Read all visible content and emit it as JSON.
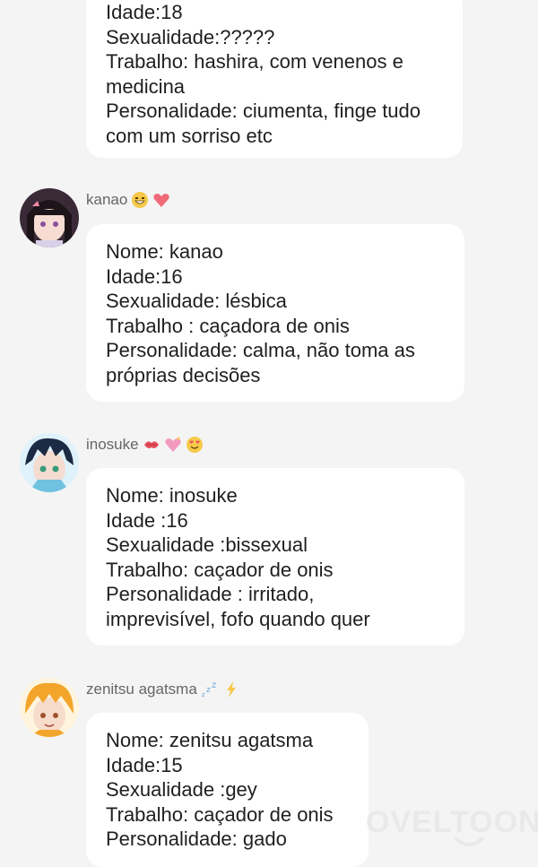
{
  "messages": [
    {
      "username": "",
      "emojis": [],
      "lines": [
        "Idade:18",
        "Sexualidade:?????",
        "Trabalho: hashira, com venenos e",
        "medicina",
        "Personalidade: ciumenta, finge tudo",
        "com um sorriso etc"
      ]
    },
    {
      "username": "kanao",
      "emojis": [
        "grinning-face-emoji",
        "red-heart-emoji"
      ],
      "lines": [
        "Nome: kanao",
        "Idade:16",
        "Sexualidade: lésbica",
        "Trabalho : caçadora de onis",
        "Personalidade: calma, não toma as",
        "próprias decisões"
      ]
    },
    {
      "username": "inosuke",
      "emojis": [
        "kiss-mark-emoji",
        "sparkling-heart-emoji",
        "heart-eyes-emoji"
      ],
      "lines": [
        "Nome: inosuke",
        "Idade :16",
        "Sexualidade :bissexual",
        "Trabalho: caçador de onis",
        "Personalidade : irritado,",
        "imprevisível, fofo quando quer"
      ]
    },
    {
      "username": "zenitsu agatsma",
      "emojis": [
        "zzz-emoji",
        "lightning-emoji"
      ],
      "lines": [
        "Nome: zenitsu agatsma",
        "Idade:15",
        "Sexualidade :gey",
        "Trabalho: caçador de onis",
        "Personalidade: gado"
      ]
    }
  ],
  "watermark": "OVELTOON",
  "colors": {
    "background": "#f4f4f4",
    "bubble": "#ffffff",
    "text": "#1f1f1f",
    "username": "#666666",
    "heart": "#f06a78"
  }
}
